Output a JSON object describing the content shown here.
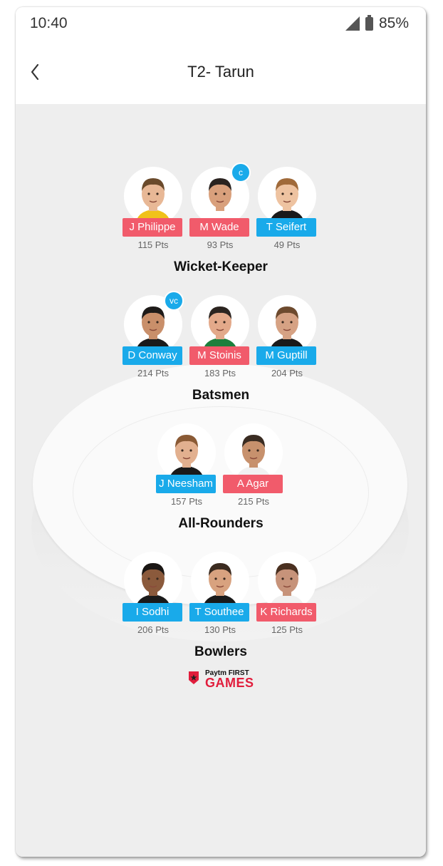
{
  "status_bar": {
    "time": "10:40",
    "battery": "85%"
  },
  "header": {
    "title": "T2- Tarun"
  },
  "sections": [
    {
      "label": "Wicket-Keeper",
      "players": [
        {
          "name": "J Philippe",
          "points": "115 Pts",
          "tag_color": "#f15b6b"
        },
        {
          "name": "M Wade",
          "points": "93 Pts",
          "tag_color": "#f15b6b",
          "badge": "c"
        },
        {
          "name": "T Seifert",
          "points": "49 Pts",
          "tag_color": "#19aaea"
        }
      ]
    },
    {
      "label": "Batsmen",
      "players": [
        {
          "name": "D Conway",
          "points": "214 Pts",
          "tag_color": "#19aaea",
          "badge": "vc"
        },
        {
          "name": "M Stoinis",
          "points": "183 Pts",
          "tag_color": "#f15b6b"
        },
        {
          "name": "M Guptill",
          "points": "204 Pts",
          "tag_color": "#19aaea"
        }
      ]
    },
    {
      "label": "All-Rounders",
      "players": [
        {
          "name": "J Neesham",
          "points": "157 Pts",
          "tag_color": "#19aaea"
        },
        {
          "name": "A Agar",
          "points": "215 Pts",
          "tag_color": "#f15b6b"
        }
      ]
    },
    {
      "label": "Bowlers",
      "players": [
        {
          "name": "I Sodhi",
          "points": "206 Pts",
          "tag_color": "#19aaea"
        },
        {
          "name": "T Southee",
          "points": "130 Pts",
          "tag_color": "#19aaea"
        },
        {
          "name": "K Richards",
          "points": "125 Pts",
          "tag_color": "#f15b6b"
        }
      ]
    }
  ],
  "logo": {
    "line1": "Paytm FIRST",
    "line2": "GAMES"
  },
  "icons": {
    "back": "chevron-left-icon",
    "signal": "signal-icon",
    "battery": "battery-icon"
  },
  "colors": {
    "red_team": "#f15b6b",
    "blue_team": "#19aaea",
    "background": "#eeeeee"
  }
}
